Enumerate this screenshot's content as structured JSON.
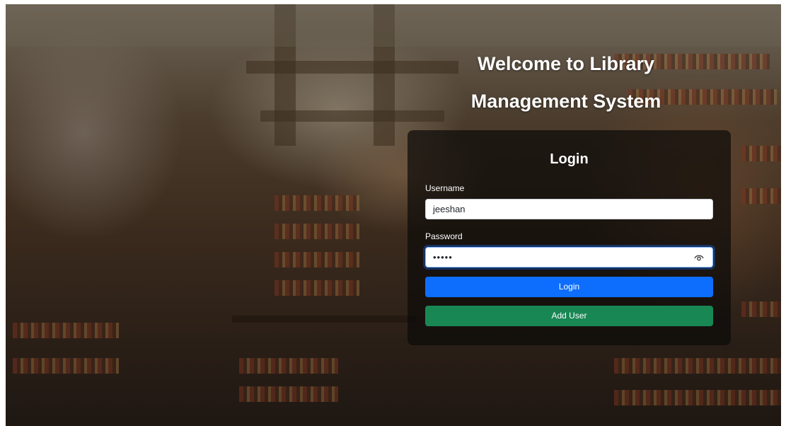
{
  "page": {
    "title": "Welcome to Library Management System"
  },
  "login_form": {
    "heading": "Login",
    "username_label": "Username",
    "username_value": "jeeshan",
    "password_label": "Password",
    "password_mask": "•••••",
    "login_button": "Login",
    "add_user_button": "Add User"
  },
  "icons": {
    "password_toggle": "eye-icon"
  },
  "colors": {
    "login_button": "#0d6efd",
    "add_user_button": "#198754",
    "card_background": "#0c0a08",
    "title_text": "#ffffff"
  }
}
